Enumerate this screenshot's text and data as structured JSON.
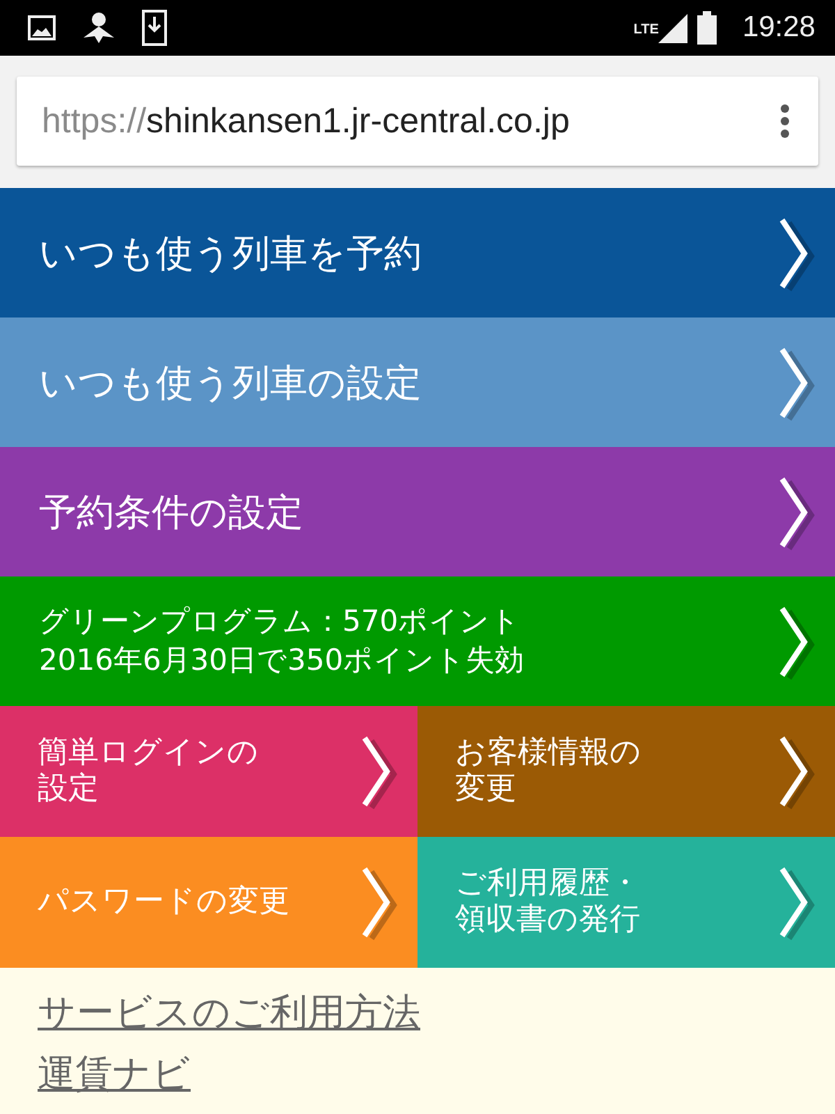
{
  "status_bar": {
    "network": "LTE",
    "time": "19:28"
  },
  "address_bar": {
    "scheme": "https://",
    "host": "shinkansen1.jr-central.co.jp"
  },
  "menu": [
    {
      "label": "いつも使う列車を予約",
      "color": "#0a5598"
    },
    {
      "label": "いつも使う列車の設定",
      "color": "#5b94c7"
    },
    {
      "label": "予約条件の設定",
      "color": "#8d3aa9"
    },
    {
      "label": "グリーンプログラム：570ポイント\n2016年6月30日で350ポイント失効",
      "color": "#009a00",
      "kind": "two-line"
    }
  ],
  "tiles": [
    {
      "lines": [
        "簡単ログインの",
        "設定"
      ],
      "color": "#dc3067"
    },
    {
      "lines": [
        "お客様情報の",
        "変更"
      ],
      "color": "#9b5a05"
    },
    {
      "lines": [
        "パスワードの変更"
      ],
      "color": "#fb8d21"
    },
    {
      "lines": [
        "ご利用履歴・",
        "領収書の発行"
      ],
      "color": "#25b29b"
    }
  ],
  "links": [
    "サービスのご利用方法",
    "運賃ナビ"
  ]
}
